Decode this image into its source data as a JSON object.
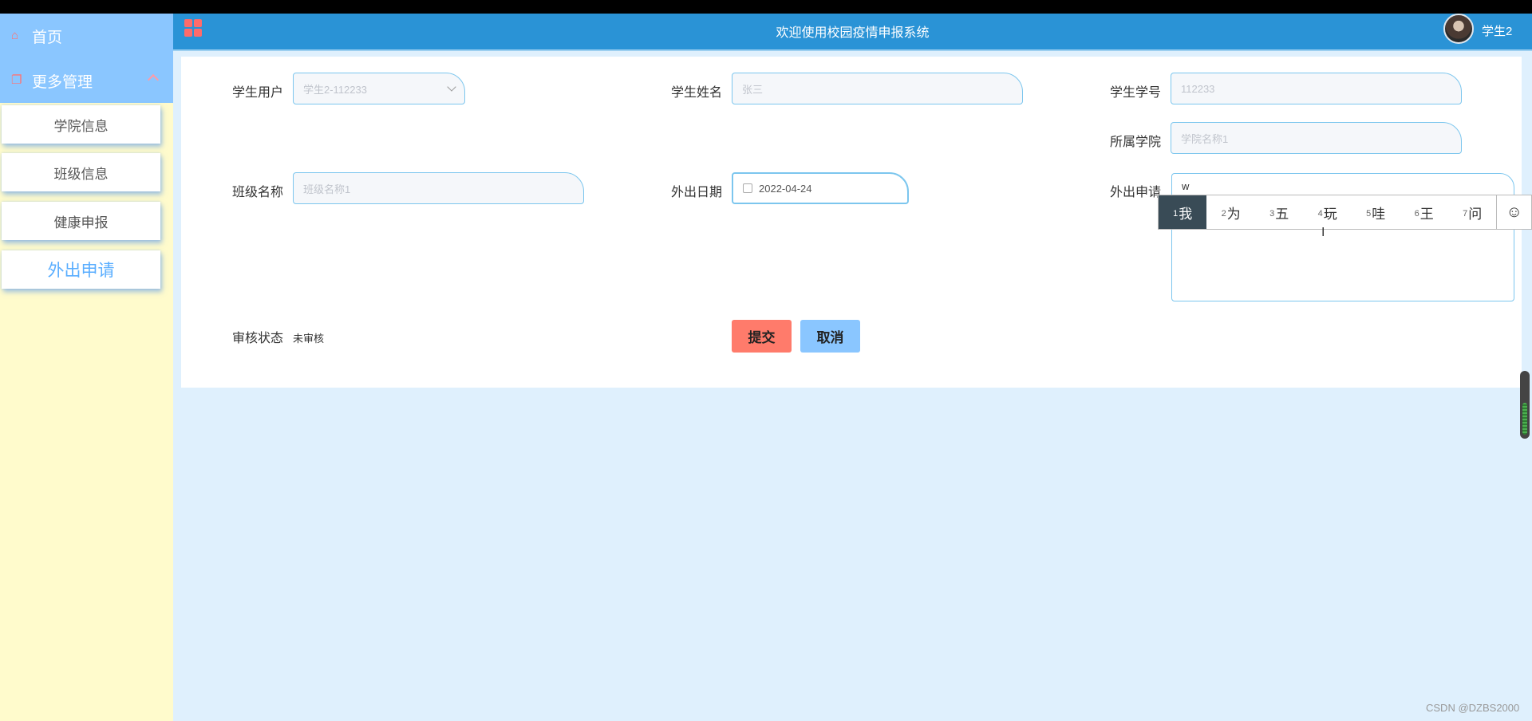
{
  "sidebar": {
    "home": "首页",
    "more": "更多管理",
    "items": [
      {
        "label": "学院信息"
      },
      {
        "label": "班级信息"
      },
      {
        "label": "健康申报"
      },
      {
        "label": "外出申请"
      }
    ]
  },
  "header": {
    "title": "欢迎使用校园疫情申报系统",
    "user": "学生2"
  },
  "form": {
    "student_user": {
      "label": "学生用户",
      "placeholder": "学生2-112233"
    },
    "student_name": {
      "label": "学生姓名",
      "placeholder": "张三"
    },
    "student_no": {
      "label": "学生学号",
      "placeholder": "112233"
    },
    "college": {
      "label": "所属学院",
      "placeholder": "学院名称1"
    },
    "class_name": {
      "label": "班级名称",
      "placeholder": "班级名称1"
    },
    "out_date": {
      "label": "外出日期",
      "value": "2022-04-24"
    },
    "out_reason": {
      "label": "外出申请",
      "value": "w"
    },
    "audit_status": {
      "label": "审核状态",
      "value": "未审核"
    },
    "submit": "提交",
    "cancel": "取消"
  },
  "ime": {
    "candidates": [
      {
        "n": "1",
        "text": "我"
      },
      {
        "n": "2",
        "text": "为"
      },
      {
        "n": "3",
        "text": "五"
      },
      {
        "n": "4",
        "text": "玩"
      },
      {
        "n": "5",
        "text": "哇"
      },
      {
        "n": "6",
        "text": "王"
      },
      {
        "n": "7",
        "text": "问"
      }
    ],
    "emoji": "☺"
  },
  "watermark": "CSDN @DZBS2000",
  "colors": {
    "header": "#2a93d6",
    "sidebar": "#fffbcc",
    "accent": "#8ac6ff",
    "submit": "#ff7b6b"
  }
}
